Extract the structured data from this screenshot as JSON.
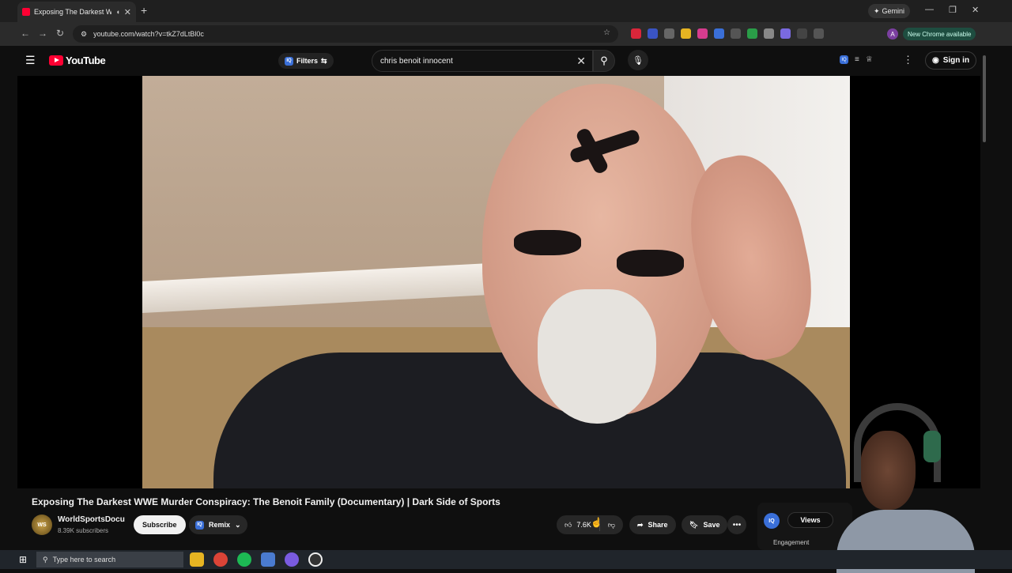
{
  "browser": {
    "tab_title": "Exposing The Darkest WWE",
    "url": "youtube.com/watch?v=tkZ7dLtBl0c",
    "gemini_label": "Gemini",
    "new_chrome_label": "New Chrome available",
    "profile_initial": "A"
  },
  "youtube": {
    "logo_text": "YouTube",
    "filters_label": "Filters",
    "search_value": "chris benoit innocent",
    "sign_in_label": "Sign in"
  },
  "video": {
    "title": "Exposing The Darkest WWE Murder Conspiracy: The Benoit Family (Documentary) | Dark Side of Sports",
    "channel_name": "WorldSportsDocu",
    "subscribers": "8.39K subscribers",
    "subscribe_label": "Subscribe",
    "remix_label": "Remix",
    "like_count": "7.6K",
    "share_label": "Share",
    "save_label": "Save"
  },
  "iq_panel": {
    "badge": "IQ",
    "views_label": "Views",
    "engagement_label": "Engagement"
  },
  "taskbar": {
    "search_placeholder": "Type here to search"
  },
  "colors": {
    "youtube_red": "#ff0033",
    "background": "#0f0f0f",
    "chip": "#272727",
    "iq_blue": "#3a6fd8"
  }
}
